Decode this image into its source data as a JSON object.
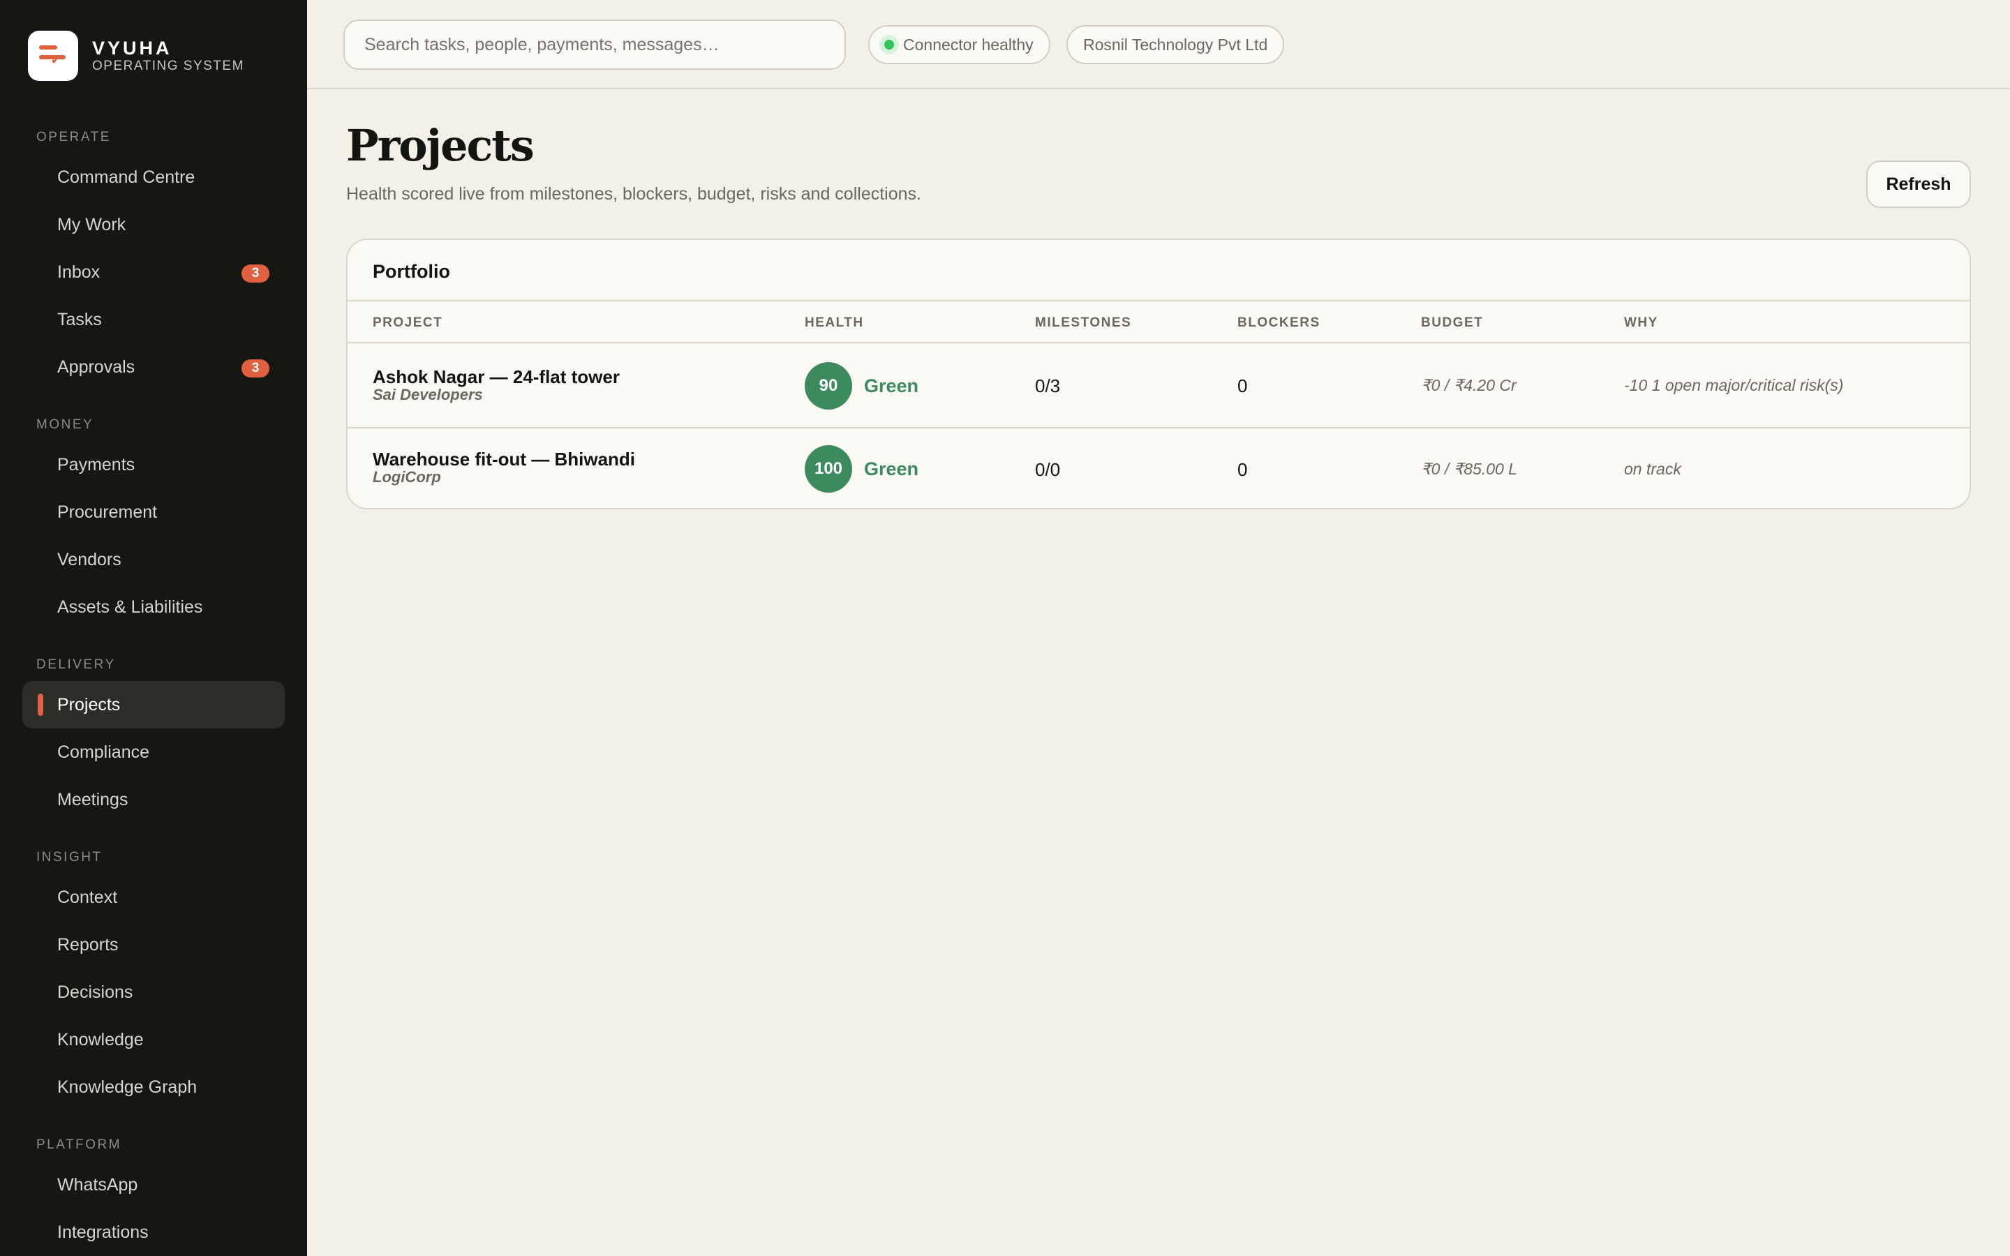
{
  "brand": {
    "name": "VYUHA",
    "subtitle": "OPERATING SYSTEM"
  },
  "sidebar": {
    "sections": [
      {
        "label": "OPERATE",
        "items": [
          {
            "label": "Command Centre"
          },
          {
            "label": "My Work"
          },
          {
            "label": "Inbox",
            "badge": "3"
          },
          {
            "label": "Tasks"
          },
          {
            "label": "Approvals",
            "badge": "3"
          }
        ]
      },
      {
        "label": "MONEY",
        "items": [
          {
            "label": "Payments"
          },
          {
            "label": "Procurement"
          },
          {
            "label": "Vendors"
          },
          {
            "label": "Assets & Liabilities"
          }
        ]
      },
      {
        "label": "DELIVERY",
        "items": [
          {
            "label": "Projects",
            "active": true
          },
          {
            "label": "Compliance"
          },
          {
            "label": "Meetings"
          }
        ]
      },
      {
        "label": "INSIGHT",
        "items": [
          {
            "label": "Context"
          },
          {
            "label": "Reports"
          },
          {
            "label": "Decisions"
          },
          {
            "label": "Knowledge"
          },
          {
            "label": "Knowledge Graph"
          }
        ]
      },
      {
        "label": "PLATFORM",
        "items": [
          {
            "label": "WhatsApp"
          },
          {
            "label": "Integrations"
          }
        ]
      }
    ]
  },
  "topbar": {
    "search_placeholder": "Search tasks, people, payments, messages…",
    "connector_status": "Connector healthy",
    "organization": "Rosnil Technology Pvt Ltd"
  },
  "page": {
    "title": "Projects",
    "subtitle": "Health scored live from milestones, blockers, budget, risks and collections.",
    "refresh_label": "Refresh"
  },
  "portfolio": {
    "title": "Portfolio",
    "columns": [
      "PROJECT",
      "HEALTH",
      "MILESTONES",
      "BLOCKERS",
      "BUDGET",
      "WHY"
    ],
    "rows": [
      {
        "name": "Ashok Nagar — 24-flat tower",
        "client": "Sai Developers",
        "score": "90",
        "status": "Green",
        "milestones": "0/3",
        "blockers": "0",
        "budget": "₹0 / ₹4.20 Cr",
        "why": "-10 1 open major/critical risk(s)"
      },
      {
        "name": "Warehouse fit-out — Bhiwandi",
        "client": "LogiCorp",
        "score": "100",
        "status": "Green",
        "milestones": "0/0",
        "blockers": "0",
        "budget": "₹0 / ₹85.00 L",
        "why": "on track"
      }
    ]
  },
  "colors": {
    "accent": "#e0603f",
    "health_green": "#3d8a5f",
    "connector_dot": "#2ec45a",
    "sidebar_bg": "#161713",
    "page_bg": "#f4efe7"
  }
}
